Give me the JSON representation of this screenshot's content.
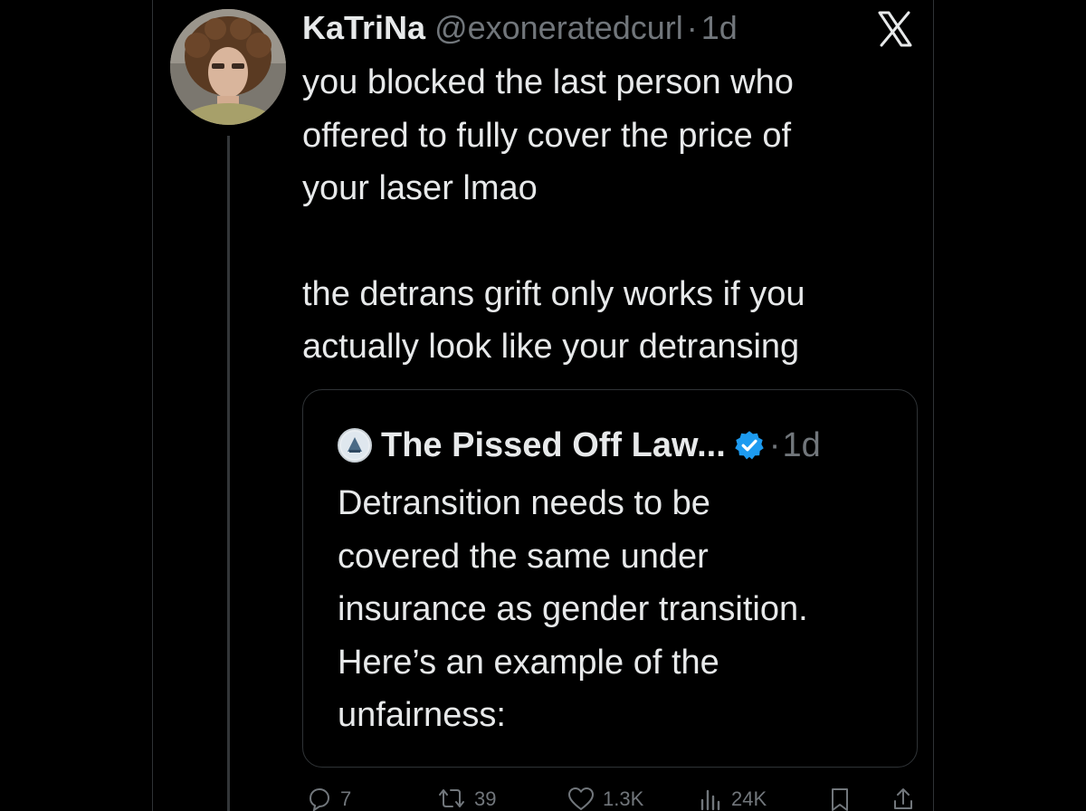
{
  "tweet": {
    "author_name": "KaTriNa",
    "handle": "@exoneratedcurl",
    "separator": "·",
    "time": "1d",
    "text_paragraphs": [
      "you blocked the last person who\noffered to fully cover the price of\nyour laser lmao",
      "the detrans grift only works if you\nactually look like your detransing"
    ],
    "colors": {
      "text": "#e7e9ea",
      "secondary": "#71767b",
      "border": "#2f3336",
      "verified": "#1d9bf0"
    }
  },
  "quoted_tweet": {
    "author_name": "The Pissed Off Law...",
    "verified": true,
    "separator": "·",
    "time": "1d",
    "text": "Detransition needs to be\ncovered the same under\ninsurance as gender transition.\nHere’s an example of the\nunfairness:"
  },
  "actions": {
    "reply": {
      "icon": "reply-icon",
      "count": "7"
    },
    "retweet": {
      "icon": "retweet-icon",
      "count": "39"
    },
    "like": {
      "icon": "heart-icon",
      "count": "1.3K"
    },
    "views": {
      "icon": "views-icon",
      "count": "24K"
    },
    "bookmark": {
      "icon": "bookmark-icon"
    },
    "share": {
      "icon": "share-icon"
    }
  },
  "logo": {
    "icon": "x-logo-icon"
  }
}
